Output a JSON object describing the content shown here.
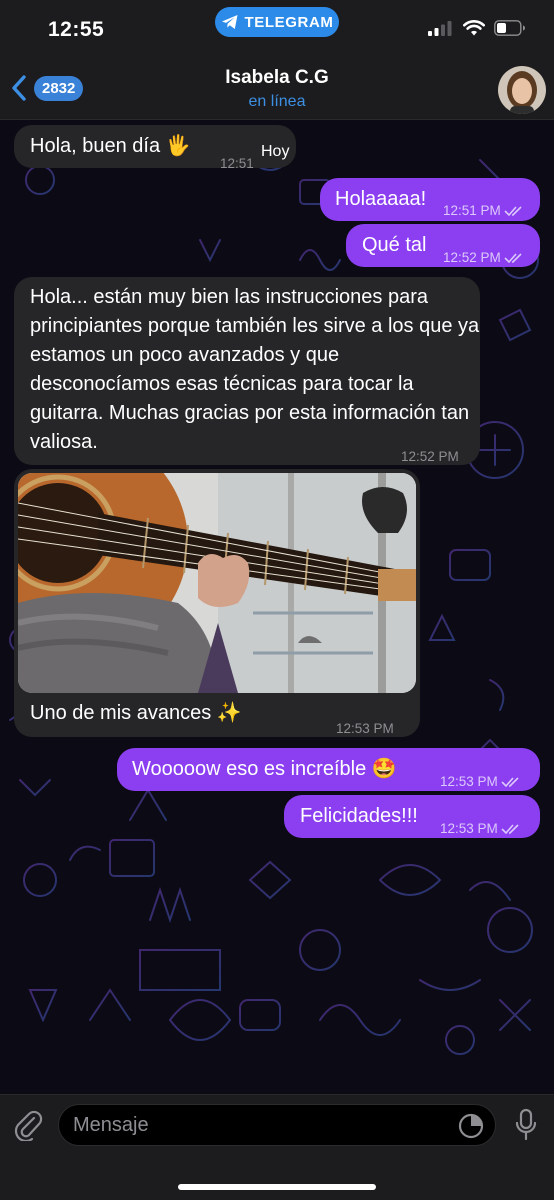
{
  "status_bar": {
    "time": "12:55",
    "app_label": "TELEGRAM"
  },
  "header": {
    "unread_count": "2832",
    "title": "Isabela C.G",
    "status": "en línea"
  },
  "messages": [
    {
      "text": "Hola, buen día 🖐",
      "time": "12:51"
    },
    {
      "text": "Holaaaaa!",
      "time": "12:51 PM"
    },
    {
      "text": "Qué tal",
      "time": "12:52 PM"
    },
    {
      "text": "Hola... están muy bien las instrucciones para principiantes porque también les sirve a los que ya estamos un poco avanzados y que desconocíamos esas técnicas para tocar la guitarra. Muchas gracias por esta información tan valiosa.",
      "time": "12:52 PM"
    },
    {
      "text": "Uno de mis avances ✨",
      "time": "12:53 PM"
    },
    {
      "text": "Wooooow eso es increíble 🤩",
      "time": "12:53 PM"
    },
    {
      "text": "Felicidades!!!",
      "time": "12:53 PM"
    }
  ],
  "date_label": "Hoy",
  "input": {
    "placeholder": "Mensaje"
  },
  "colors": {
    "outgoing": "#8b3ff0",
    "incoming": "#262628",
    "accent": "#3d8fe4",
    "background": "#0c0a14"
  },
  "icons": [
    "back-chevron-icon",
    "paperclip-icon",
    "sticker-icon",
    "microphone-icon",
    "read-check-icon",
    "telegram-plane-icon",
    "signal-icon",
    "wifi-icon",
    "battery-icon"
  ]
}
